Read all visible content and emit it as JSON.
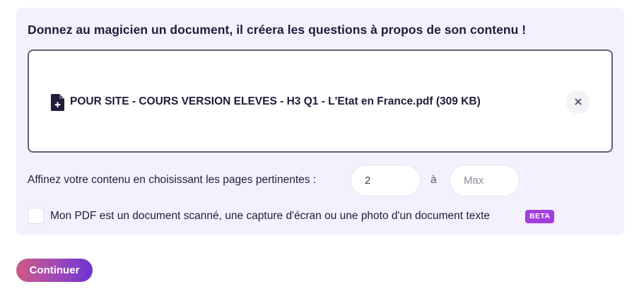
{
  "generator": {
    "heading": "Donnez au magicien un document, il créera les questions à propos de son contenu !",
    "file": {
      "icon": "file-plus-icon",
      "name": "POUR SITE - COURS VERSION ELEVES - H3 Q1 - L'Etat en France.pdf (309 KB)",
      "remove_icon": "close-icon"
    },
    "pages": {
      "label": "Affinez votre contenu en choisissant les pages pertinentes :",
      "from_value": "2",
      "from_placeholder": "",
      "separator": "à",
      "to_value": "",
      "to_placeholder": "Max"
    },
    "scanned": {
      "label": "Mon PDF est un document scanné, une capture d'écran ou une photo d'un document texte",
      "badge": "BETA",
      "checked": false
    },
    "continue_label": "Continuer"
  },
  "colors": {
    "panel_bg": "#f4f1fe",
    "text": "#1f1d3a",
    "badge": "#a23de0",
    "button_gradient_start": "#cc5a86",
    "button_gradient_end": "#6d33d3"
  }
}
